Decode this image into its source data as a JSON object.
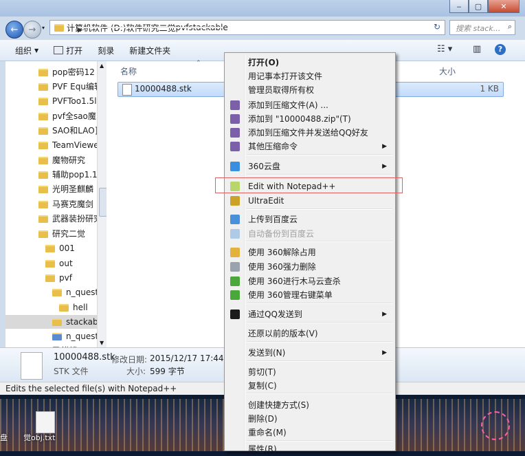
{
  "window": {
    "minimize": "‒",
    "maximize": "▢",
    "close": "✕"
  },
  "address": {
    "crumbs": [
      "计算机",
      "软件 (D:)",
      "软件",
      "研究二觉",
      "pvf",
      "stackable"
    ],
    "search_placeholder": "搜索 stack..."
  },
  "toolbar": {
    "organize": "组织",
    "open": "打开",
    "burn": "刻录",
    "new_folder": "新建文件夹"
  },
  "nav": {
    "items": [
      "pop密码12",
      "PVF Equ编辑",
      "PVFToo1.5l",
      "pvf全sao魔",
      "SAO和LAO]",
      "TeamViewe",
      "魔物研究",
      "辅助pop1.1",
      "光明圣麒麟",
      "马赛克魔剑",
      "武器装扮研究",
      "研究二觉",
      "001",
      "out",
      "pvf",
      "n_quest",
      "hell",
      "stackab",
      "n_quest",
      "圣麒麟"
    ]
  },
  "columns": {
    "name": "名称",
    "size": "大小"
  },
  "file": {
    "name": "10000488.stk",
    "size": "1 KB"
  },
  "details": {
    "name": "10000488.stk",
    "type": "STK 文件",
    "modified_label": "修改日期:",
    "modified": "2015/12/17 17:44",
    "size_label": "大小:",
    "size": "599 字节"
  },
  "status": "Edits the selected file(s) with Notepad++",
  "menu": {
    "items": [
      {
        "label": "打开(O)",
        "bold": true
      },
      {
        "label": "用记事本打开该文件"
      },
      {
        "label": "管理员取得所有权"
      },
      {
        "label": "添加到压缩文件(A) ...",
        "icon": "winrar-icon"
      },
      {
        "label": "添加到 \"10000488.zip\"(T)",
        "icon": "winrar-icon"
      },
      {
        "label": "添加到压缩文件并发送给QQ好友",
        "icon": "winrar-icon"
      },
      {
        "label": "其他压缩命令",
        "icon": "winrar-icon",
        "sub": true
      },
      {
        "label": "360云盘",
        "icon": "cloud-icon",
        "sub": true
      },
      {
        "label": "Edit with Notepad++",
        "icon": "notepad-icon"
      },
      {
        "label": "UltraEdit",
        "icon": "ultraedit-icon"
      },
      {
        "label": "上传到百度云",
        "icon": "baidu-icon"
      },
      {
        "label": "自动备份到百度云",
        "icon": "baidu-icon",
        "disabled": true
      },
      {
        "label": "使用 360解除占用",
        "icon": "unlock-icon"
      },
      {
        "label": "使用 360强力删除",
        "icon": "shred-icon"
      },
      {
        "label": "使用 360进行木马云查杀",
        "icon": "shield-icon"
      },
      {
        "label": "使用 360管理右键菜单",
        "icon": "shield-icon"
      },
      {
        "label": "通过QQ发送到",
        "icon": "qq-icon",
        "sub": true
      },
      {
        "label": "还原以前的版本(V)"
      },
      {
        "label": "发送到(N)",
        "sub": true
      },
      {
        "label": "剪切(T)"
      },
      {
        "label": "复制(C)"
      },
      {
        "label": "创建快捷方式(S)"
      },
      {
        "label": "删除(D)"
      },
      {
        "label": "重命名(M)"
      },
      {
        "label": "属性(R)"
      }
    ]
  },
  "desktop": {
    "icon_label": "觉obj.txt",
    "left_label": "盘"
  },
  "colors": {
    "selection": "#c1dbfc",
    "highlight_box": "#e06060",
    "accent": "#2d5ea8"
  }
}
